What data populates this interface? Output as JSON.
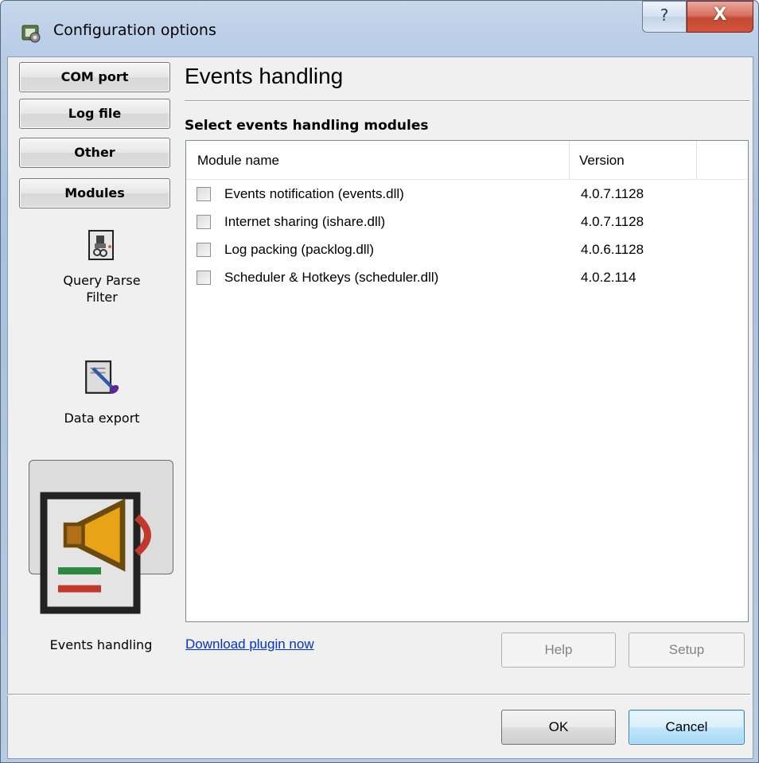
{
  "window": {
    "title": "Configuration options",
    "help_glyph": "?",
    "close_glyph": "X"
  },
  "sidebar": {
    "nav_buttons": [
      {
        "label": "COM port"
      },
      {
        "label": "Log file"
      },
      {
        "label": "Other"
      },
      {
        "label": "Modules"
      }
    ],
    "items": [
      {
        "label": "Query Parse\nFilter",
        "icon": "query-parse-filter-icon"
      },
      {
        "label": "Data export",
        "icon": "data-export-icon"
      },
      {
        "label": "Events handling",
        "icon": "events-handling-icon",
        "selected": true
      }
    ]
  },
  "content": {
    "heading": "Events handling",
    "subheading": "Select events handling modules",
    "columns": [
      "Module name",
      "Version",
      ""
    ],
    "modules": [
      {
        "name": "Events notification (events.dll)",
        "version": "4.0.7.1128",
        "checked": false
      },
      {
        "name": "Internet sharing (ishare.dll)",
        "version": "4.0.7.1128",
        "checked": false
      },
      {
        "name": "Log packing (packlog.dll)",
        "version": "4.0.6.1128",
        "checked": false
      },
      {
        "name": "Scheduler & Hotkeys (scheduler.dll)",
        "version": "4.0.2.114",
        "checked": false
      }
    ],
    "download_link": "Download plugin now",
    "help_label": "Help",
    "setup_label": "Setup"
  },
  "footer": {
    "ok_label": "OK",
    "cancel_label": "Cancel"
  },
  "colors": {
    "title_bar": "#b9cde6",
    "close_button": "#c24a33",
    "link": "#0033cc",
    "dialog_face": "#f0f0f0"
  }
}
